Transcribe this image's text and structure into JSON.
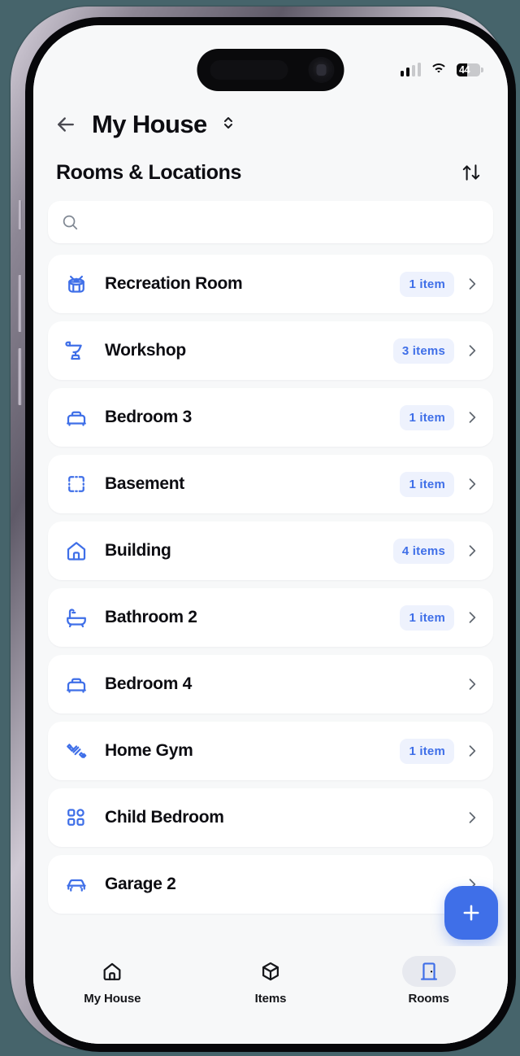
{
  "status_bar": {
    "signal_icon": "cellular-signal-icon",
    "wifi_icon": "wifi-icon",
    "battery_icon": "battery-icon",
    "battery_percent": "44"
  },
  "navbar": {
    "back_icon": "back-arrow-icon",
    "title": "My House",
    "selector_icon": "chevron-up-down-icon"
  },
  "section": {
    "title": "Rooms & Locations",
    "sort_icon": "sort-arrows-icon"
  },
  "search": {
    "icon": "search-icon",
    "value": "",
    "placeholder": ""
  },
  "rooms": [
    {
      "name": "Recreation Room",
      "icon": "drum-icon",
      "badge": "1 item",
      "chevron_icon": "chevron-right-icon"
    },
    {
      "name": "Workshop",
      "icon": "anvil-icon",
      "badge": "3 items",
      "chevron_icon": "chevron-right-icon"
    },
    {
      "name": "Bedroom 3",
      "icon": "bed-icon",
      "badge": "1 item",
      "chevron_icon": "chevron-right-icon"
    },
    {
      "name": "Basement",
      "icon": "dashed-box-icon",
      "badge": "1 item",
      "chevron_icon": "chevron-right-icon"
    },
    {
      "name": "Building",
      "icon": "home-icon",
      "badge": "4 items",
      "chevron_icon": "chevron-right-icon"
    },
    {
      "name": "Bathroom 2",
      "icon": "bathtub-icon",
      "badge": "1 item",
      "chevron_icon": "chevron-right-icon"
    },
    {
      "name": "Bedroom 4",
      "icon": "bed-icon",
      "badge": "",
      "chevron_icon": "chevron-right-icon"
    },
    {
      "name": "Home Gym",
      "icon": "dumbbell-icon",
      "badge": "1 item",
      "chevron_icon": "chevron-right-icon"
    },
    {
      "name": "Child Bedroom",
      "icon": "blocks-icon",
      "badge": "",
      "chevron_icon": "chevron-right-icon"
    },
    {
      "name": "Garage 2",
      "icon": "car-icon",
      "badge": "",
      "chevron_icon": "chevron-right-icon"
    }
  ],
  "fab": {
    "icon": "plus-icon",
    "label": "+"
  },
  "tabbar": {
    "items": [
      {
        "label": "My House",
        "icon": "home-icon",
        "active": false
      },
      {
        "label": "Items",
        "icon": "cube-icon",
        "active": false
      },
      {
        "label": "Rooms",
        "icon": "door-icon",
        "active": true
      }
    ]
  },
  "colors": {
    "accent": "#3f6fe8",
    "badge_bg": "#eef2fd",
    "screen_bg": "#f7f8f9",
    "card_bg": "#ffffff",
    "text": "#0d0d12"
  }
}
